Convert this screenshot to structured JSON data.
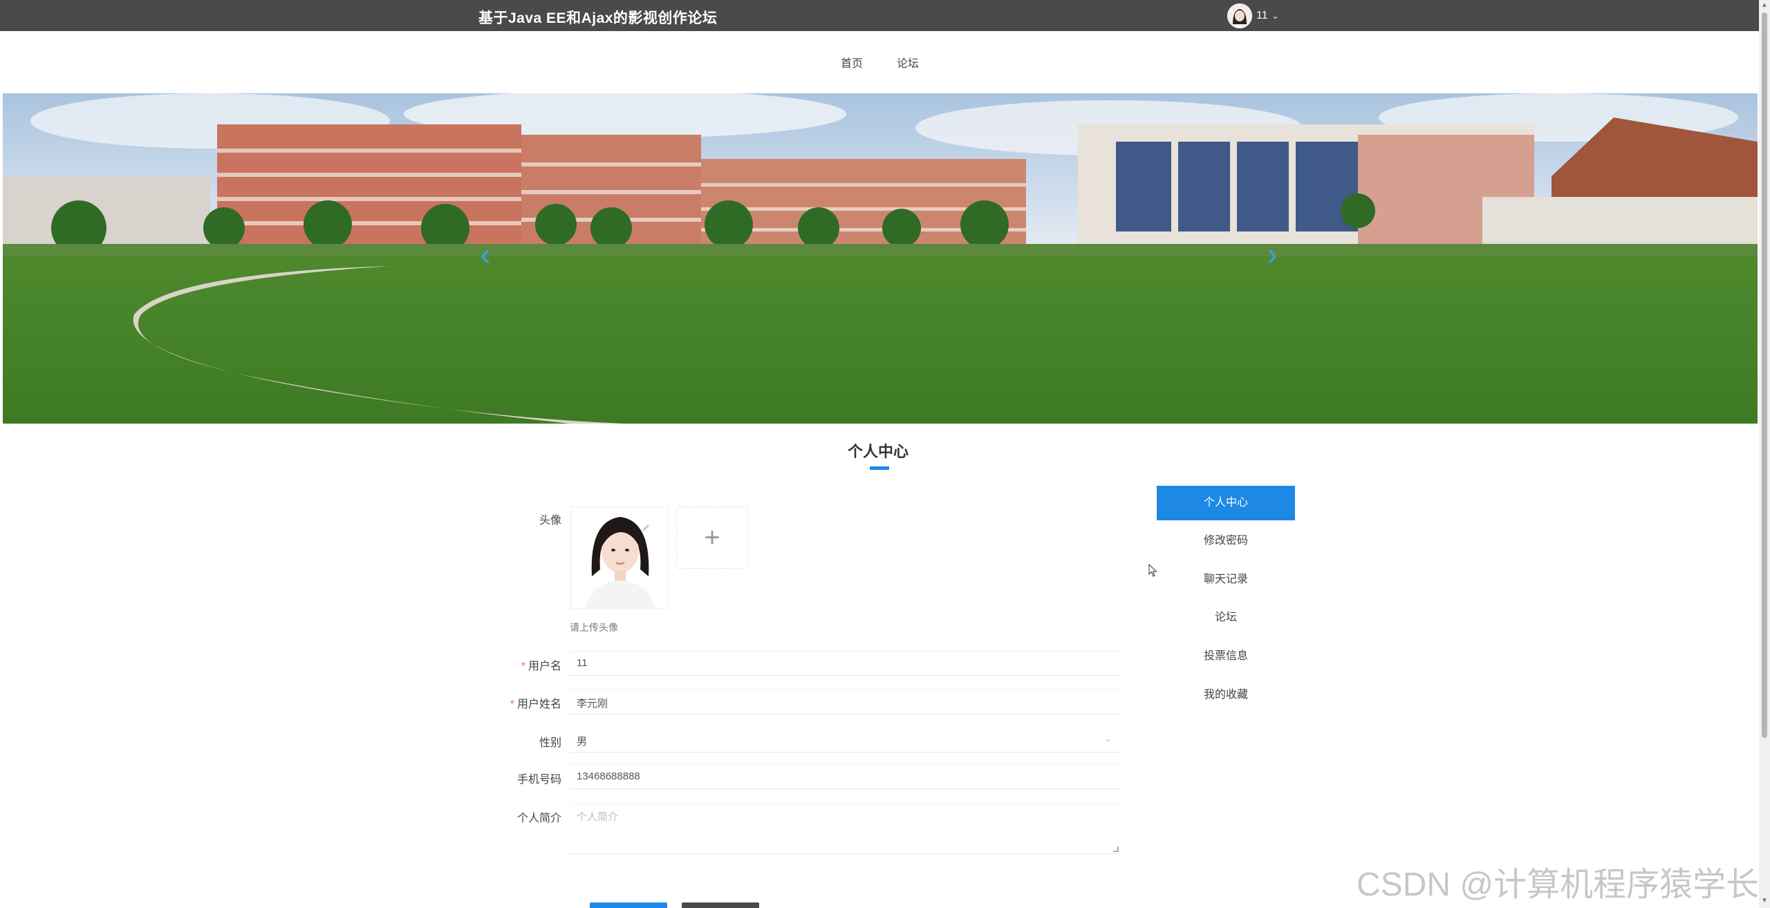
{
  "header": {
    "site_title": "基于Java EE和Ajax的影视创作论坛",
    "user_name": "11"
  },
  "nav": {
    "items": [
      "首页",
      "论坛"
    ]
  },
  "page": {
    "title": "个人中心"
  },
  "form": {
    "avatar_label": "头像",
    "upload_hint": "请上传头像",
    "username_label": "用户名",
    "username_value": "11",
    "realname_label": "用户姓名",
    "realname_value": "李元刚",
    "gender_label": "性别",
    "gender_value": "男",
    "phone_label": "手机号码",
    "phone_value": "13468688888",
    "bio_label": "个人简介",
    "bio_placeholder": "个人简介"
  },
  "side_menu": {
    "items": [
      "个人中心",
      "修改密码",
      "聊天记录",
      "论坛",
      "投票信息",
      "我的收藏"
    ],
    "active_index": 0
  },
  "colors": {
    "accent": "#1e88e5",
    "topbar": "#4a4a4a",
    "required": "#f56c6c"
  },
  "watermark": "CSDN @计算机程序猿学长"
}
